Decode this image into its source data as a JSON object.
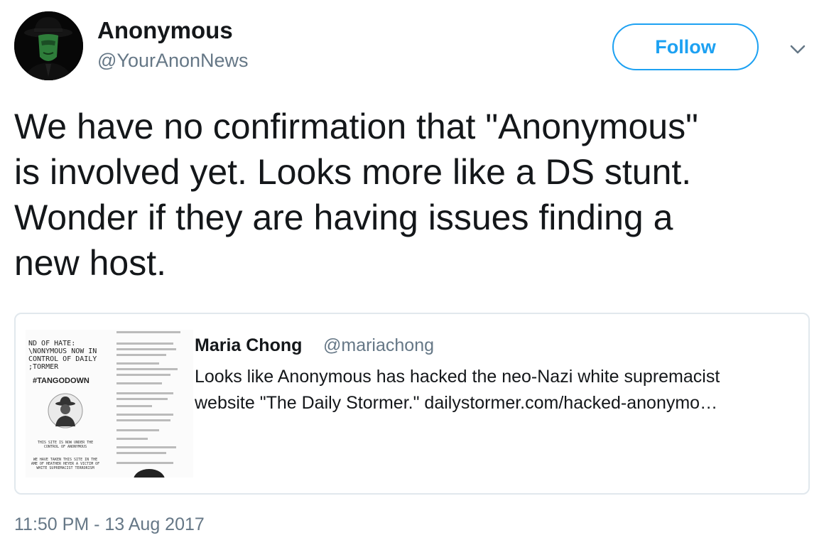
{
  "author": {
    "display_name": "Anonymous",
    "handle": "@YourAnonNews",
    "avatar_icon": "anonymous-mask-avatar-icon"
  },
  "actions": {
    "follow_label": "Follow",
    "more_icon": "chevron-down-icon"
  },
  "tweet": {
    "text_lines": [
      "We have no confirmation that \"Anonymous\"",
      "is involved yet. Looks more like a DS stunt.",
      "Wonder if they are having issues finding a",
      "new host."
    ],
    "timestamp": "11:50 PM - 13 Aug 2017"
  },
  "quoted_tweet": {
    "name": "Maria Chong",
    "handle": "@mariachong",
    "text_lines": [
      "Looks like Anonymous has hacked the neo-Nazi white supremacist",
      "website \"The Daily Stormer.\" dailystormer.com/hacked-anonymo…"
    ],
    "image": {
      "headline": "ND OF HATE:\n\\NONYMOUS NOW IN\nCONTROL OF DAILY\n;TORMER",
      "hashtag": "#TANGODOWN",
      "footer_1": "THIS SITE IS NOW UNDER THE\nCONTROL OF ANONYMOUS",
      "footer_2": "WE HAVE TAKEN THIS SITE IN THE\nAME OF HEATHER HEYER A VICTIM OF\nWHITE SUPREMACIST TERRORISM",
      "emblem_icon": "anonymous-emblem-icon"
    }
  },
  "colors": {
    "accent": "#1da1f2",
    "secondary_text": "#657786",
    "primary_text": "#14171a",
    "border": "#e1e8ed"
  }
}
